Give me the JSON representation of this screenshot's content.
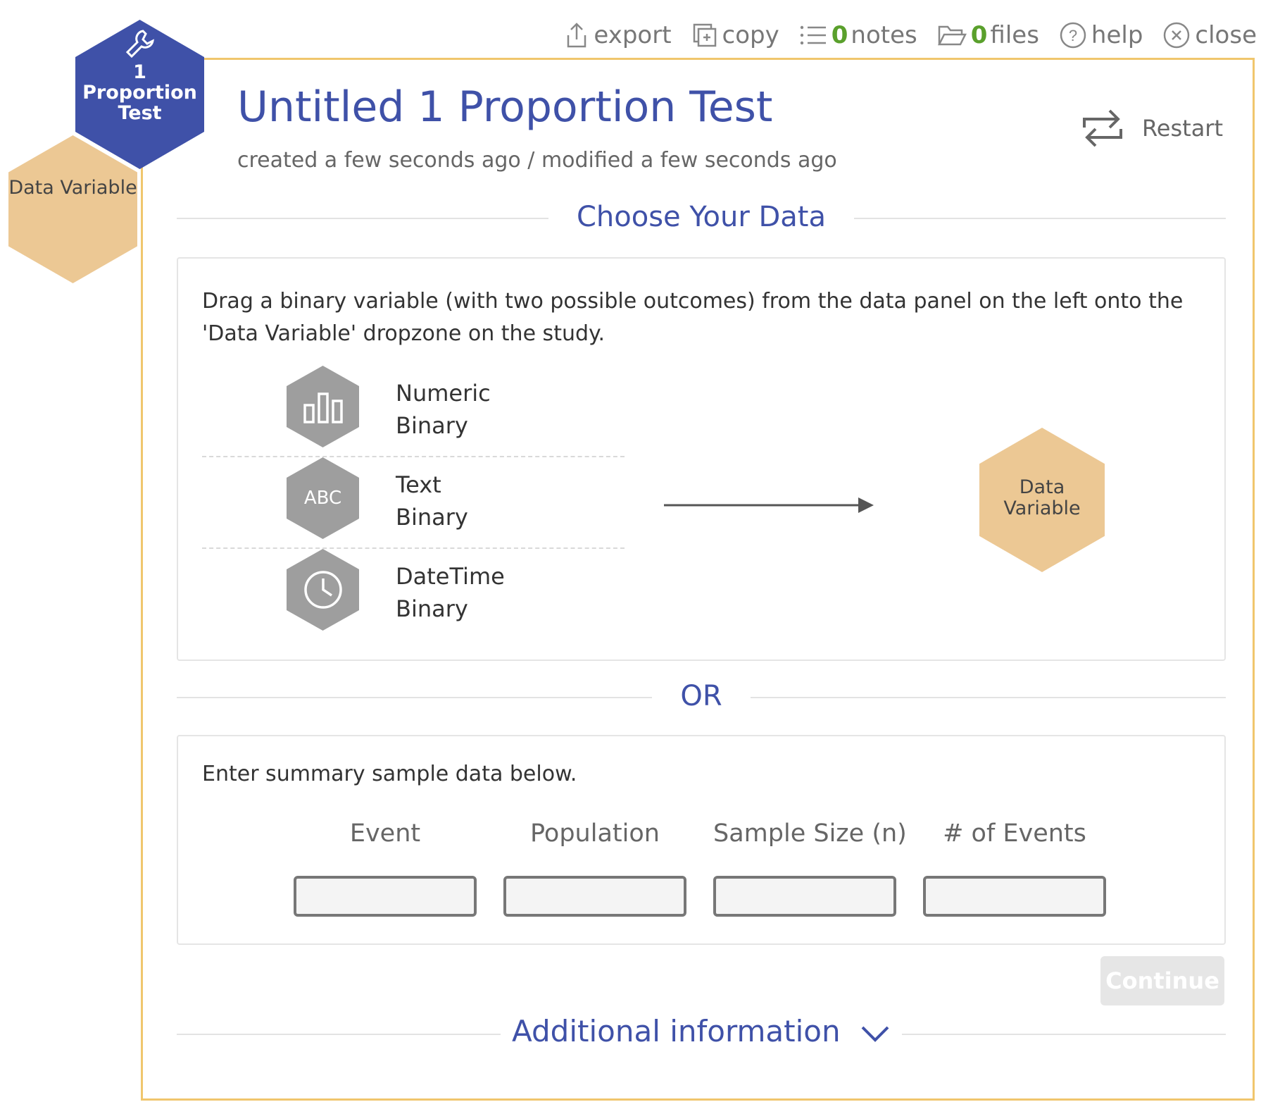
{
  "toolbar": {
    "export": "export",
    "copy": "copy",
    "notes_count": "0",
    "notes": "notes",
    "files_count": "0",
    "files": "files",
    "help": "help",
    "close": "close"
  },
  "side": {
    "study_label": "1 Proportion Test",
    "variable_label": "Data Variable"
  },
  "header": {
    "title": "Untitled 1 Proportion Test",
    "subtitle": "created a few seconds ago / modified a few seconds ago",
    "restart": "Restart"
  },
  "choose": {
    "heading": "Choose Your Data",
    "instruction": "Drag a binary variable (with two possible outcomes) from the data panel on the left onto the 'Data Variable' dropzone on the study.",
    "types": [
      {
        "line1": "Numeric",
        "line2": "Binary",
        "icon": "bar-chart-icon"
      },
      {
        "line1": "Text",
        "line2": "Binary",
        "icon_text": "ABC"
      },
      {
        "line1": "DateTime",
        "line2": "Binary",
        "icon": "clock-icon"
      }
    ],
    "dropzone": "Data Variable"
  },
  "or_label": "OR",
  "summary": {
    "instruction": "Enter summary sample data below.",
    "fields": [
      {
        "label": "Event",
        "value": ""
      },
      {
        "label": "Population",
        "value": ""
      },
      {
        "label": "Sample Size (n)",
        "value": ""
      },
      {
        "label": "# of Events",
        "value": ""
      }
    ]
  },
  "continue": "Continue",
  "additional": "Additional information",
  "colors": {
    "accent": "#3f51a8",
    "panel_border": "#f0c66d",
    "variable_hex": "#ecc894",
    "count_green": "#5aa02c"
  }
}
